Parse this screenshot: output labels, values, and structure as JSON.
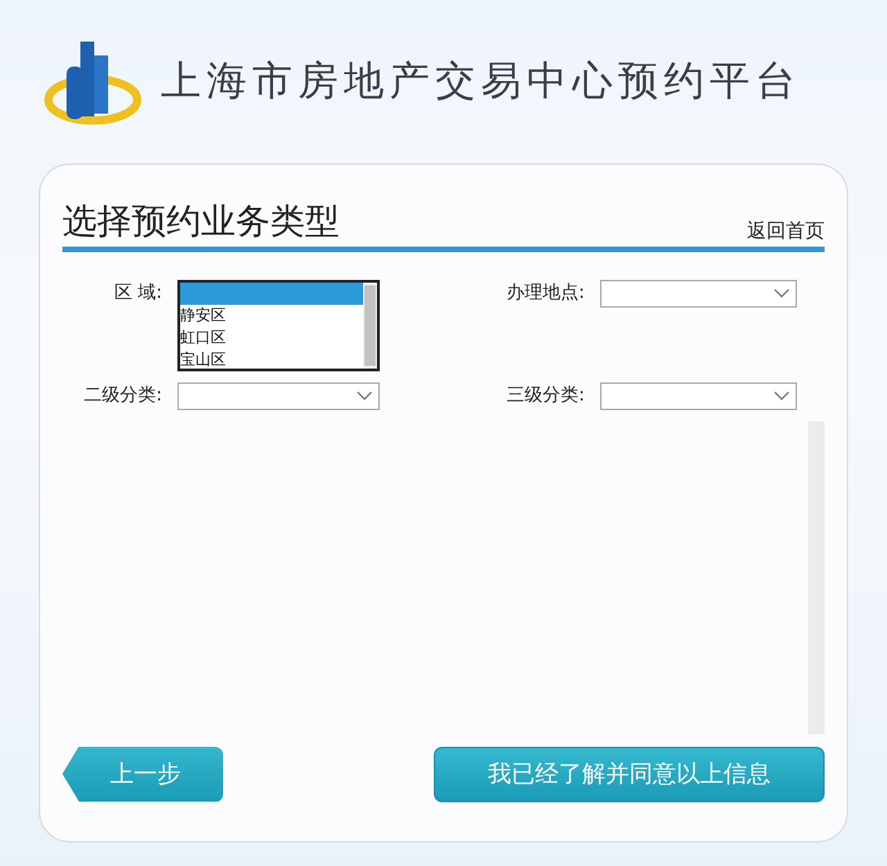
{
  "header": {
    "title": "上海市房地产交易中心预约平台"
  },
  "panel": {
    "title": "选择预约业务类型",
    "home_link": "返回首页"
  },
  "fields": [
    {
      "kind": "listbox",
      "label": "区 域:",
      "options": [
        {
          "selected": true
        },
        {
          "label": "静安区",
          "selected": false
        },
        {
          "label": "虹口区",
          "selected": false
        },
        {
          "label": "宝山区",
          "selected": false
        }
      ]
    },
    {
      "kind": "select",
      "label": "办理地点:"
    },
    {
      "kind": "select",
      "label": "二级分类:"
    },
    {
      "kind": "select",
      "label": "三级分类:"
    }
  ],
  "buttons": {
    "back": "上一步",
    "agree": "我已经了解并同意以上信息"
  }
}
